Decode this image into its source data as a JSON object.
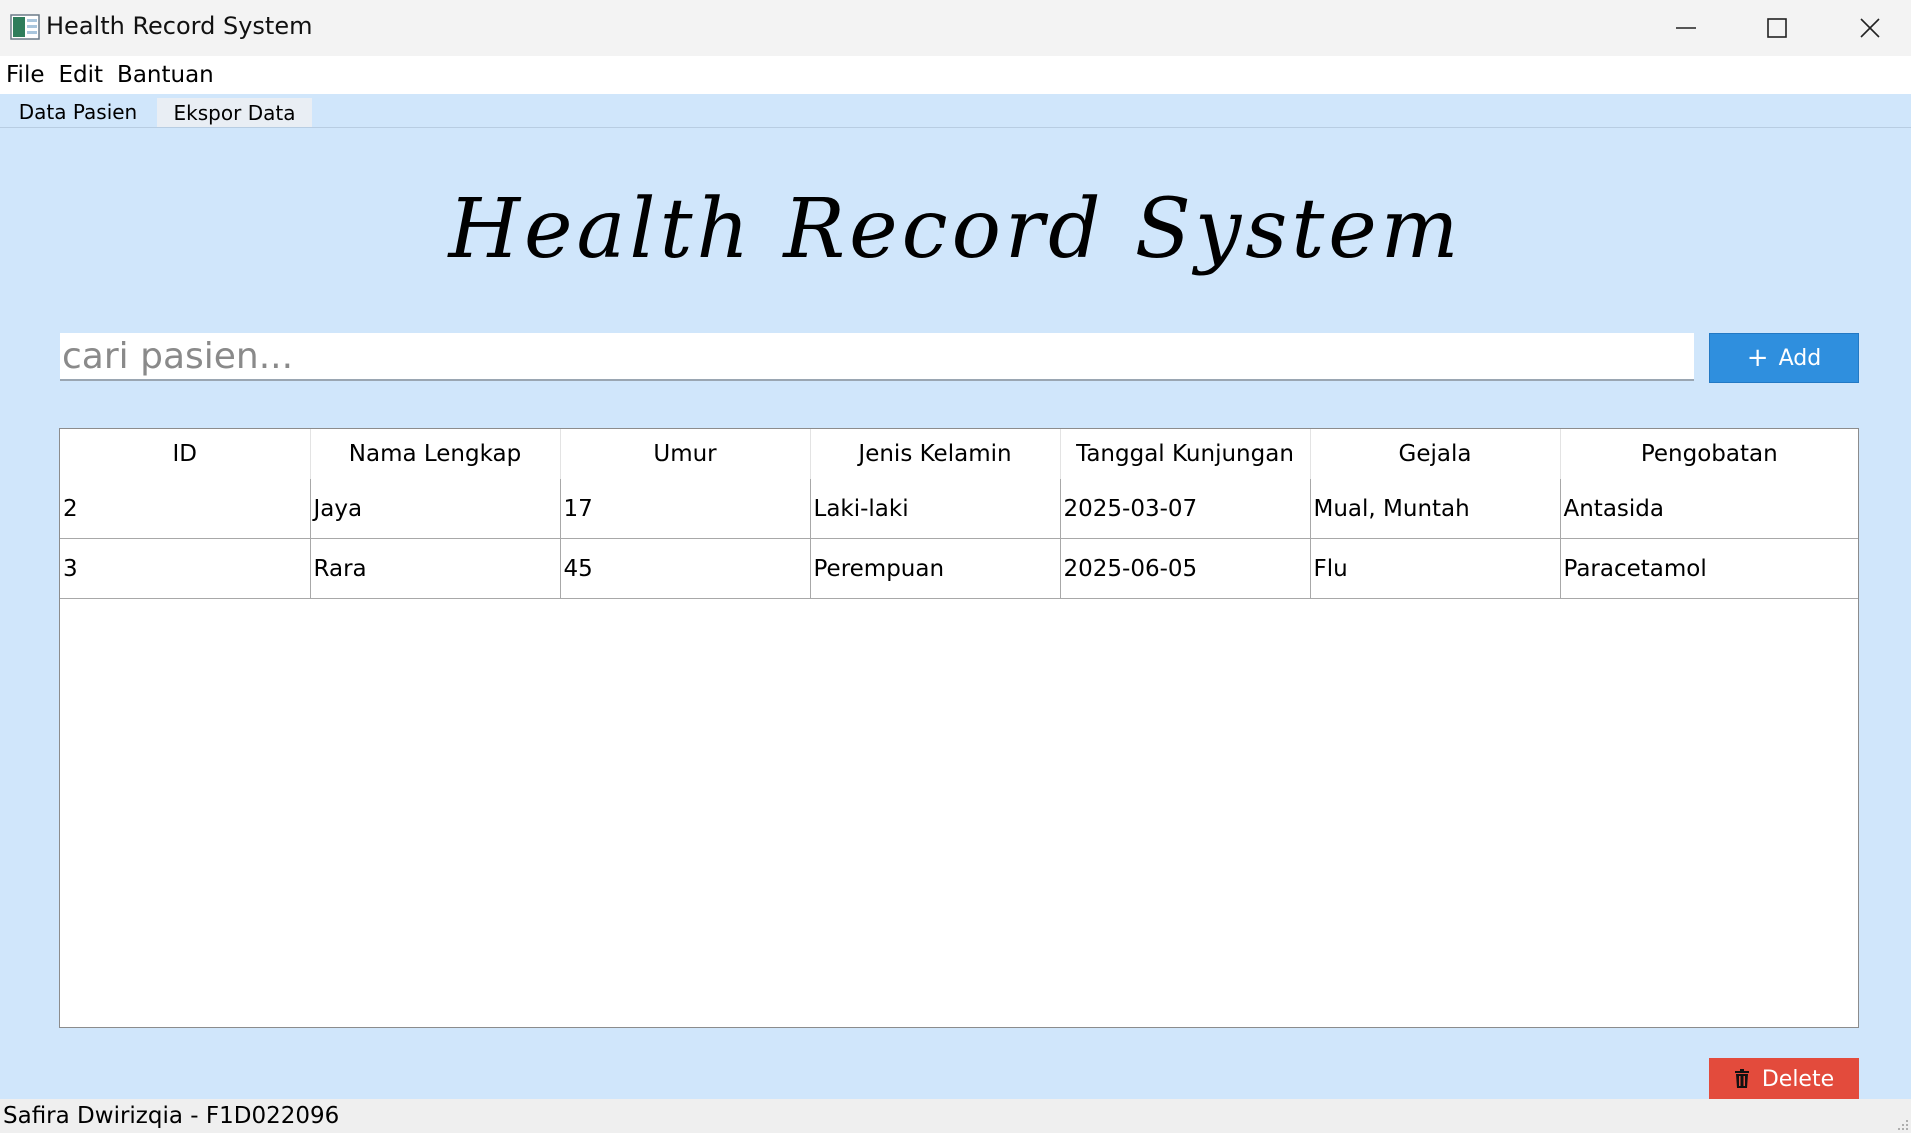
{
  "window": {
    "title": "Health Record System"
  },
  "menu": [
    "File",
    "Edit",
    "Bantuan"
  ],
  "tabs": [
    "Data Pasien",
    "Ekspor Data"
  ],
  "heading": "Health Record System",
  "search": {
    "placeholder": "cari pasien..."
  },
  "add_button": {
    "icon": "+",
    "label": "Add"
  },
  "table": {
    "columns": [
      "ID",
      "Nama Lengkap",
      "Umur",
      "Jenis Kelamin",
      "Tanggal Kunjungan",
      "Gejala",
      "Pengobatan"
    ],
    "rows": [
      [
        "2",
        "Jaya",
        "17",
        "Laki-laki",
        "2025-03-07",
        "Mual, Muntah",
        "Antasida"
      ],
      [
        "3",
        "Rara",
        "45",
        "Perempuan",
        "2025-06-05",
        "Flu",
        "Paracetamol"
      ]
    ]
  },
  "delete_button": {
    "label": "Delete"
  },
  "status": "Safira Dwirizqia - F1D022096",
  "colors": {
    "background": "#d0e6fb",
    "add_button": "#2f8fde",
    "delete_button": "#e34b3c"
  }
}
